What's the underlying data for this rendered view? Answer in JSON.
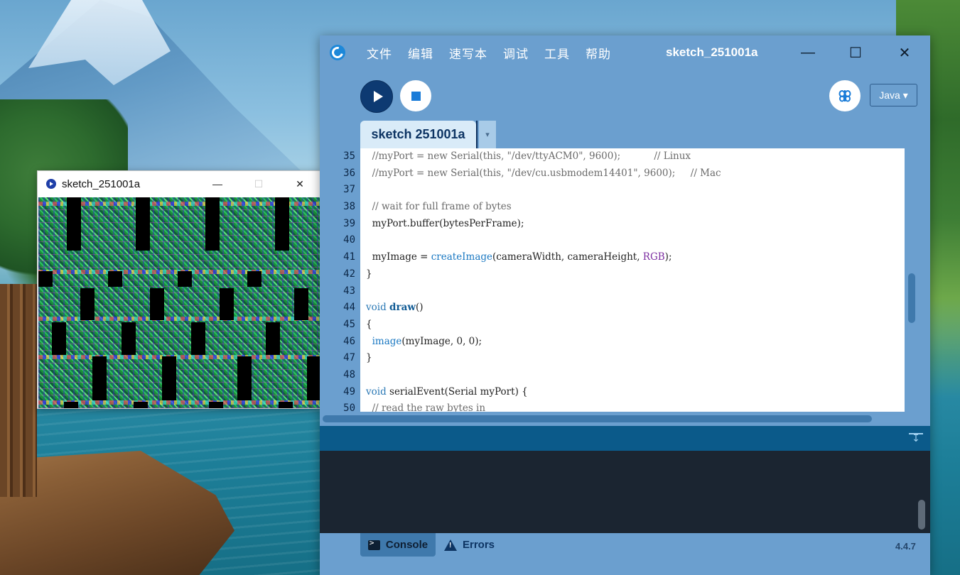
{
  "ide": {
    "menu": [
      "文件",
      "编辑",
      "速写本",
      "调试",
      "工具",
      "帮助"
    ],
    "title": "sketch_251001a",
    "window_controls": {
      "minimize": "—",
      "maximize": "☐",
      "close": "✕"
    },
    "mode": "Java ▾",
    "tab": {
      "label": "sketch 251001a",
      "arrow": "▾"
    },
    "code_lines": [
      {
        "num": "35",
        "parts": [
          {
            "t": "  //myPort = new Serial(this, \"/dev/ttyACM0\", 9600);           // Linux",
            "c": "cmt"
          }
        ]
      },
      {
        "num": "36",
        "parts": [
          {
            "t": "  //myPort = new Serial(this, \"/dev/cu.usbmodem14401\", 9600);     // Mac",
            "c": "cmt"
          }
        ]
      },
      {
        "num": "37",
        "parts": []
      },
      {
        "num": "38",
        "parts": [
          {
            "t": "  // wait for full frame of bytes",
            "c": "cmt"
          }
        ]
      },
      {
        "num": "39",
        "parts": [
          {
            "t": "  myPort.buffer(bytesPerFrame);",
            "c": ""
          }
        ]
      },
      {
        "num": "40",
        "parts": []
      },
      {
        "num": "41",
        "parts": [
          {
            "t": "  myImage = ",
            "c": ""
          },
          {
            "t": "createImage",
            "c": "call"
          },
          {
            "t": "(cameraWidth, cameraHeight, ",
            "c": ""
          },
          {
            "t": "RGB",
            "c": "const"
          },
          {
            "t": ");",
            "c": ""
          }
        ]
      },
      {
        "num": "42",
        "parts": [
          {
            "t": "}",
            "c": ""
          }
        ]
      },
      {
        "num": "43",
        "parts": []
      },
      {
        "num": "44",
        "parts": [
          {
            "t": "void ",
            "c": "kw"
          },
          {
            "t": "draw",
            "c": "fn"
          },
          {
            "t": "()",
            "c": ""
          }
        ]
      },
      {
        "num": "45",
        "parts": [
          {
            "t": "{",
            "c": ""
          }
        ]
      },
      {
        "num": "46",
        "parts": [
          {
            "t": "  ",
            "c": ""
          },
          {
            "t": "image",
            "c": "call"
          },
          {
            "t": "(myImage, 0, 0);",
            "c": ""
          }
        ]
      },
      {
        "num": "47",
        "parts": [
          {
            "t": "}",
            "c": ""
          }
        ]
      },
      {
        "num": "48",
        "parts": []
      },
      {
        "num": "49",
        "parts": [
          {
            "t": "void ",
            "c": "kw"
          },
          {
            "t": "serialEvent(Serial myPort) {",
            "c": ""
          }
        ]
      },
      {
        "num": "50",
        "parts": [
          {
            "t": "  // read the raw bytes in",
            "c": "cmt"
          }
        ]
      }
    ],
    "footer": {
      "console_label": "Console",
      "errors_label": "Errors",
      "version": "4.4.7"
    }
  },
  "sketch_window": {
    "title": "sketch_251001a",
    "window_controls": {
      "minimize": "—",
      "maximize": "☐",
      "close": "✕"
    }
  }
}
